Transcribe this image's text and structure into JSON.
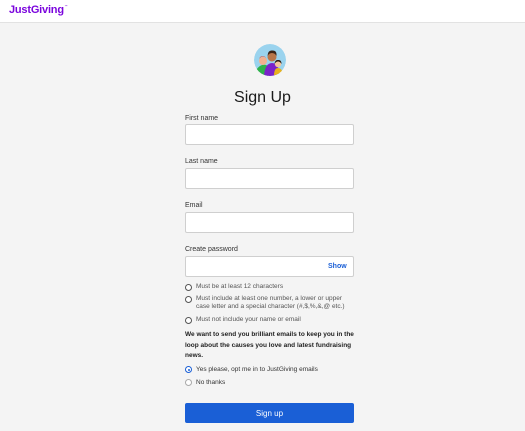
{
  "header": {
    "logo_text": "JustGiving",
    "logo_mark": "™"
  },
  "page": {
    "title": "Sign Up"
  },
  "form": {
    "first_name": {
      "label": "First name",
      "value": ""
    },
    "last_name": {
      "label": "Last name",
      "value": ""
    },
    "email": {
      "label": "Email",
      "value": ""
    },
    "password": {
      "label": "Create password",
      "value": "",
      "show_label": "Show"
    }
  },
  "password_rules": [
    "Must be at least 12 characters",
    "Must include at least one number, a lower or upper case letter and a special character (#,$,%,&,@ etc.)",
    "Must not include your name or email"
  ],
  "marketing": {
    "text": "We want to send you brilliant emails to keep you in the loop about the causes you love and latest fundraising news.",
    "options": [
      {
        "label": "Yes please, opt me in to JustGiving emails",
        "selected": true
      },
      {
        "label": "No thanks",
        "selected": false
      }
    ]
  },
  "submit": {
    "label": "Sign up"
  },
  "colors": {
    "brand": "#7a04dd",
    "primary": "#1a5fd6",
    "background": "#f4f4f4"
  },
  "icons": {
    "avatar": "user-avatar-illustration-icon"
  }
}
